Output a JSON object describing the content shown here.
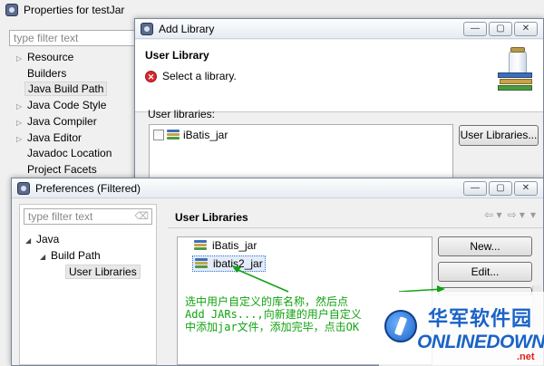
{
  "colors": {
    "annotation": "#11a311",
    "error": "#d9262c",
    "watermark_blue": "#1b63c6",
    "watermark_red": "#e21c1c"
  },
  "properties_window": {
    "title": "Properties for testJar",
    "filter_placeholder": "type filter text",
    "tree": [
      {
        "label": "Resource",
        "expandable": true
      },
      {
        "label": "Builders",
        "expandable": false
      },
      {
        "label": "Java Build Path",
        "expandable": false,
        "selected": true
      },
      {
        "label": "Java Code Style",
        "expandable": true
      },
      {
        "label": "Java Compiler",
        "expandable": true
      },
      {
        "label": "Java Editor",
        "expandable": true
      },
      {
        "label": "Javadoc Location",
        "expandable": false
      },
      {
        "label": "Project Facets",
        "expandable": false
      }
    ]
  },
  "add_library_dialog": {
    "title": "Add Library",
    "header_title": "User Library",
    "header_message": "Select a library.",
    "error_icon": "error-icon",
    "list_label": "User libraries:",
    "libraries": [
      {
        "name": "iBatis_jar",
        "checked": false
      }
    ],
    "user_libraries_button": "User Libraries..."
  },
  "preferences_window": {
    "title": "Preferences (Filtered)",
    "filter_placeholder": "type filter text",
    "tree": [
      {
        "label": "Java",
        "level": 0
      },
      {
        "label": "Build Path",
        "level": 1
      },
      {
        "label": "User Libraries",
        "level": 2,
        "selected": true
      }
    ],
    "page_title": "User Libraries",
    "libraries": [
      {
        "name": "iBatis_jar"
      },
      {
        "name": "ibatis2_jar",
        "selected": true
      }
    ],
    "buttons": {
      "new": "New...",
      "edit": "Edit..."
    }
  },
  "annotation": {
    "line1": "选中用户自定义的库名称，然后点",
    "line2": "Add JARs...,向新建的用户自定义",
    "line3": "中添加jar文件，添加完毕，点击OK"
  },
  "watermark": {
    "cn": "华军软件园",
    "en": "ONLINEDOWN",
    "suffix": ".net"
  }
}
